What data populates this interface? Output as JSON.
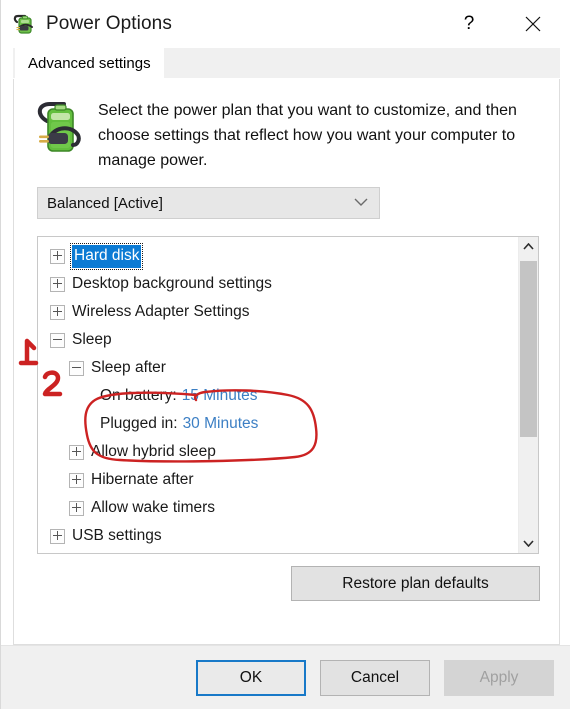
{
  "window": {
    "title": "Power Options",
    "icon": "battery-plug-icon",
    "help_label": "?",
    "close_label": "✕"
  },
  "tabs": [
    {
      "label": "Advanced settings",
      "active": true
    }
  ],
  "intro": {
    "icon": "battery-plug-icon",
    "text": "Select the power plan that you want to customize, and then choose settings that reflect how you want your computer to manage power."
  },
  "plan_select": {
    "value": "Balanced [Active]",
    "chevron": "chevron-down-icon"
  },
  "tree": {
    "items": [
      {
        "label": "Hard disk",
        "level": 0,
        "expander": "plus",
        "selected": true
      },
      {
        "label": "Desktop background settings",
        "level": 0,
        "expander": "plus",
        "selected": false
      },
      {
        "label": "Wireless Adapter Settings",
        "level": 0,
        "expander": "plus",
        "selected": false
      },
      {
        "label": "Sleep",
        "level": 0,
        "expander": "minus",
        "selected": false
      },
      {
        "label": "Sleep after",
        "level": 1,
        "expander": "minus",
        "selected": false
      },
      {
        "label": "On battery:",
        "value": "15 Minutes",
        "level": 2,
        "expander": "none",
        "selected": false
      },
      {
        "label": "Plugged in:",
        "value": "30 Minutes",
        "level": 2,
        "expander": "none",
        "selected": false
      },
      {
        "label": "Allow hybrid sleep",
        "level": 1,
        "expander": "plus",
        "selected": false
      },
      {
        "label": "Hibernate after",
        "level": 1,
        "expander": "plus",
        "selected": false
      },
      {
        "label": "Allow wake timers",
        "level": 1,
        "expander": "plus",
        "selected": false
      },
      {
        "label": "USB settings",
        "level": 0,
        "expander": "plus",
        "selected": false
      }
    ],
    "scrollbar": {
      "up_icon": "chevron-up-icon",
      "down_icon": "chevron-down-icon"
    }
  },
  "buttons": {
    "restore": "Restore plan defaults",
    "ok": "OK",
    "cancel": "Cancel",
    "apply": "Apply"
  },
  "annotations": {
    "color": "#cc2222",
    "marker_one": "1",
    "marker_two": "2",
    "ellipse": "hand-drawn-ellipse-around-sleep-after-values"
  },
  "colors": {
    "selection_blue": "#0c7bd4",
    "value_blue": "#3c7fc4",
    "focus_blue": "#1879c8",
    "annotation_red": "#cc2222",
    "window_bg": "#ffffff",
    "chrome_bg": "#f0f0f0"
  }
}
